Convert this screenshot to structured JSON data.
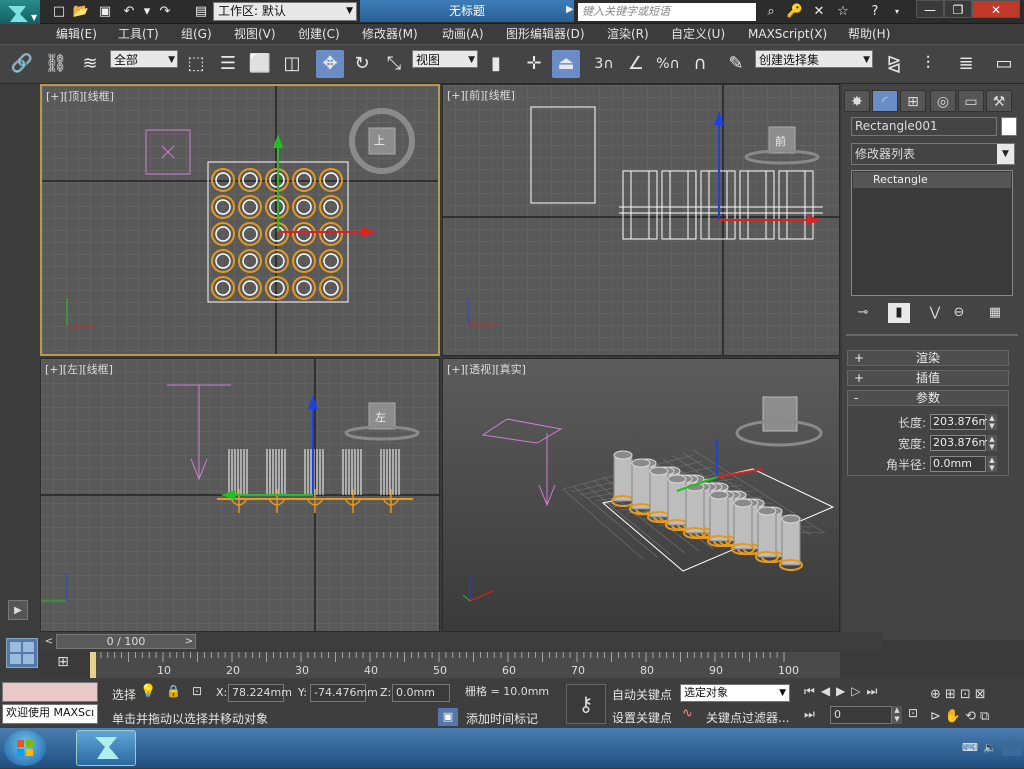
{
  "titlebar": {
    "workspace_label": "工作区: 默认",
    "document_title": "无标题",
    "search_placeholder": "键入关键字或短语"
  },
  "menu": [
    "编辑(E)",
    "工具(T)",
    "组(G)",
    "视图(V)",
    "创建(C)",
    "修改器(M)",
    "动画(A)",
    "图形编辑器(D)",
    "渲染(R)",
    "自定义(U)",
    "MAXScript(X)",
    "帮助(H)"
  ],
  "toolbar": {
    "selection_filter": "全部",
    "reference_coord": "视图",
    "named_selection_set": "创建选择集",
    "snap_3": "3",
    "snap_pct": "%"
  },
  "viewports": {
    "top": {
      "label": "[+][顶][线框]",
      "cube_label": "上"
    },
    "front": {
      "label": "[+][前][线框]",
      "cube_label": "前"
    },
    "left": {
      "label": "[+][左][线框]",
      "cube_label": "左"
    },
    "perspective": {
      "label": "[+][透视][真实]"
    }
  },
  "command_panel": {
    "object_name": "Rectangle001",
    "modifier_list": "修改器列表",
    "stack_item": "Rectangle",
    "rollouts": [
      {
        "sign": "+",
        "title": "渲染"
      },
      {
        "sign": "+",
        "title": "插值"
      },
      {
        "sign": "-",
        "title": "参数"
      }
    ],
    "params": [
      {
        "label": "长度:",
        "value": "203.876m"
      },
      {
        "label": "宽度:",
        "value": "203.876m"
      },
      {
        "label": "角半径:",
        "value": "0.0mm"
      }
    ]
  },
  "timeline": {
    "slider": "0 / 100",
    "ticks": [
      "10",
      "20",
      "30",
      "40",
      "50",
      "60",
      "70",
      "80",
      "90",
      "100"
    ]
  },
  "status": {
    "maxscript_listener": "欢迎使用 MAXScı",
    "selected_label": "选择",
    "x_label": "X:",
    "x_value": "78.224mm",
    "y_label": "Y:",
    "y_value": "-74.476mm",
    "z_label": "Z:",
    "z_value": "0.0mm",
    "grid": "栅格 = 10.0mm",
    "prompt": "单击并拖动以选择并移动对象",
    "add_time_tag": "添加时间标记",
    "auto_key": "自动关键点",
    "set_key": "设置关键点",
    "key_mode": "选定对象",
    "key_filters": "关键点过滤器...",
    "frame": "0"
  },
  "colors": {
    "accent_selected": "#b59b4a",
    "object_orange": "#e59a1e",
    "axis_x": "#e02020",
    "axis_y": "#20c020",
    "axis_z": "#2040e0"
  }
}
